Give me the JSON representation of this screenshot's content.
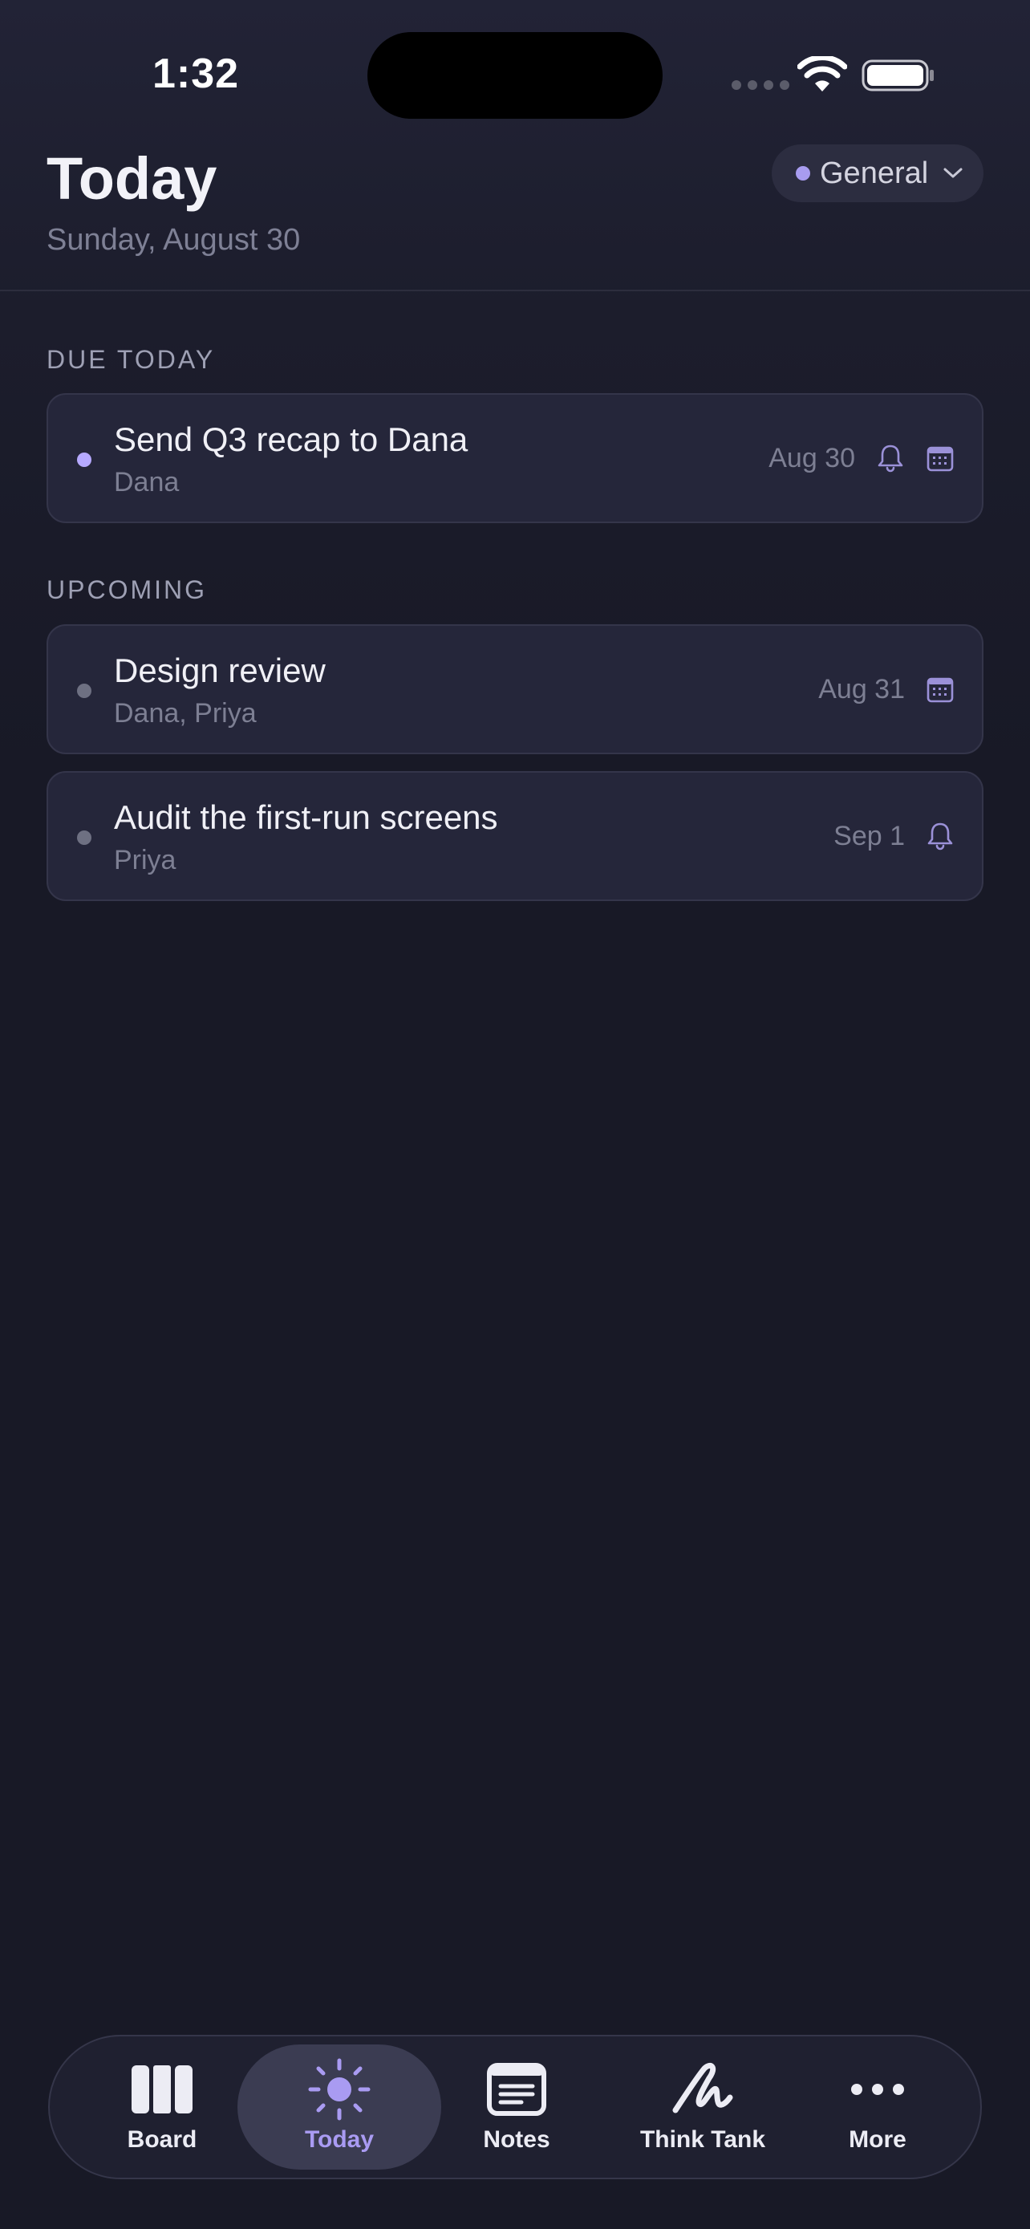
{
  "status_bar": {
    "time": "1:32"
  },
  "header": {
    "title": "Today",
    "date": "Sunday, August 30",
    "project_selector": {
      "label": "General",
      "dot_color": "#a89cf0"
    }
  },
  "sections": {
    "due_today": {
      "label": "DUE TODAY",
      "tasks": [
        {
          "title": "Send Q3 recap to Dana",
          "people": "Dana",
          "date": "Aug 30",
          "dot_color": "#b6a9ff",
          "icons": [
            "bell-icon",
            "calendar-icon"
          ]
        }
      ]
    },
    "upcoming": {
      "label": "UPCOMING",
      "tasks": [
        {
          "title": "Design review",
          "people": "Dana, Priya",
          "date": "Aug 31",
          "dot_color": "#6e7082",
          "icons": [
            "calendar-icon"
          ]
        },
        {
          "title": "Audit the first-run screens",
          "people": "Priya",
          "date": "Sep 1",
          "dot_color": "#6e7082",
          "icons": [
            "bell-icon"
          ]
        }
      ]
    }
  },
  "tab_bar": {
    "items": [
      {
        "label": "Board",
        "icon": "board-icon"
      },
      {
        "label": "Today",
        "icon": "sun-icon",
        "active": true
      },
      {
        "label": "Notes",
        "icon": "notes-icon"
      },
      {
        "label": "Think Tank",
        "icon": "scribble-icon"
      },
      {
        "label": "More",
        "icon": "more-icon"
      }
    ],
    "active_color": "#a99bf2"
  }
}
